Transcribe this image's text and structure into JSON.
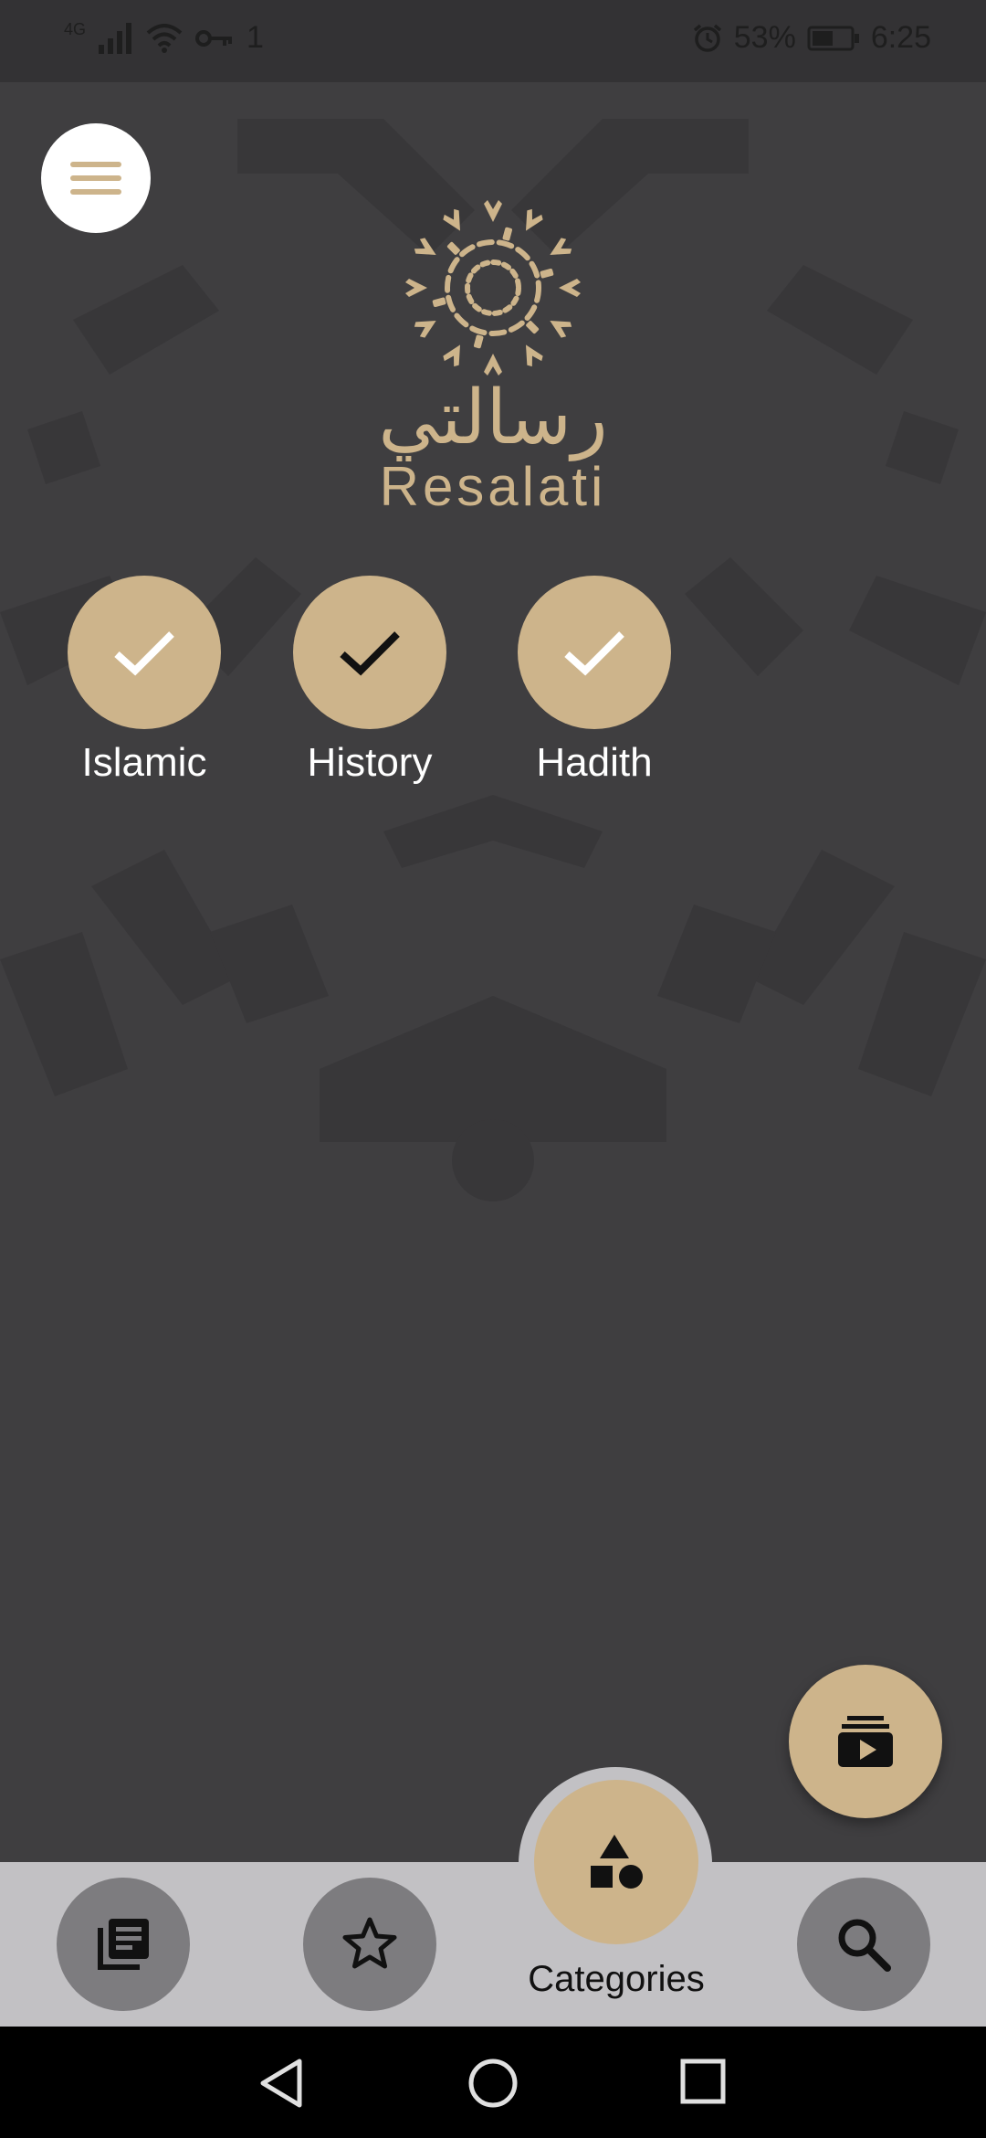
{
  "status_bar": {
    "network": "4G",
    "signal_extra": "1",
    "battery_percent": "53%",
    "time": "6:25"
  },
  "logo": {
    "arabic": "رسالتي",
    "english": "Resalati"
  },
  "categories": [
    {
      "label": "Islamic",
      "checked": true
    },
    {
      "label": "History",
      "checked": true
    },
    {
      "label": "Hadith",
      "checked": true
    }
  ],
  "bottom_nav": {
    "items": [
      {
        "icon": "articles-icon"
      },
      {
        "icon": "star-icon"
      },
      {
        "icon": "categories-icon",
        "label": "Categories",
        "active": true
      },
      {
        "icon": "search-icon"
      }
    ]
  },
  "colors": {
    "accent": "#cdb48b",
    "background": "#3f3e40",
    "nav_bar": "#c2c1c4",
    "nav_button": "#7d7c7f"
  }
}
